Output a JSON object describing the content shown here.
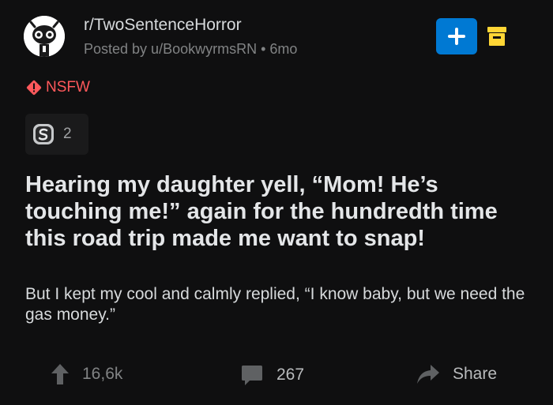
{
  "post": {
    "subreddit": "r/TwoSentenceHorror",
    "posted_by": "Posted by u/BookwyrmsRN",
    "separator": "•",
    "age": "6mo",
    "nsfw_label": "NSFW",
    "award_count": "2",
    "title": "Hearing my daughter yell, “Mom! He’s touching me!” again for the hundredth time this road trip made me want to snap!",
    "body": "But I kept my cool and calmly replied, “I know baby, but we need the gas money.”"
  },
  "actions": {
    "upvotes": "16,6k",
    "comments": "267",
    "share_label": "Share"
  },
  "icons": {
    "avatar": "subreddit-avatar-icon",
    "join": "plus-icon",
    "archive": "archive-icon",
    "nsfw": "warning-icon",
    "award": "silver-award-icon",
    "upvote": "arrow-up-icon",
    "comment": "comment-bubble-icon",
    "share": "share-arrow-icon"
  },
  "colors": {
    "background": "#0f0f10",
    "accent_blue": "#0079d3",
    "nsfw_red": "#ff585b",
    "archive_yellow": "#ffd635",
    "muted_text": "#818384"
  }
}
